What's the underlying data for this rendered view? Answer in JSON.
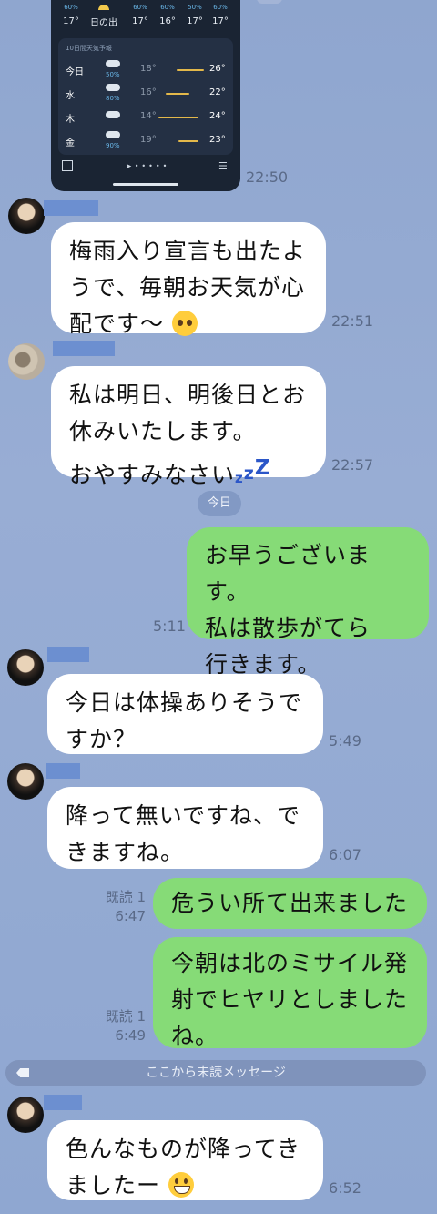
{
  "weather_card": {
    "hourly": [
      {
        "pct": "60%",
        "label": "17°"
      },
      {
        "pct": "",
        "label": "日の出"
      },
      {
        "pct": "60%",
        "label": "17°"
      },
      {
        "pct": "60%",
        "label": "16°"
      },
      {
        "pct": "50%",
        "label": "17°"
      },
      {
        "pct": "60%",
        "label": "17°"
      }
    ],
    "forecast_title": "10日間天気予報",
    "days": [
      {
        "day": "今日",
        "pct": "50%",
        "low": "18°",
        "high": "26°"
      },
      {
        "day": "水",
        "pct": "80%",
        "low": "16°",
        "high": "22°"
      },
      {
        "day": "木",
        "pct": "",
        "low": "14°",
        "high": "24°"
      },
      {
        "day": "金",
        "pct": "90%",
        "low": "19°",
        "high": "23°"
      }
    ]
  },
  "messages": [
    {
      "time": "22:50"
    },
    {
      "text_lines": [
        "梅雨入り宣言も出たよ",
        "うで、毎朝お天気が心",
        "配です〜"
      ],
      "time": "22:51",
      "emoji": "pleading-face"
    },
    {
      "text_lines": [
        "私は明日、明後日とお",
        "休みいたします。",
        "おやすみなさい"
      ],
      "time": "22:57",
      "emoji": "zzz"
    },
    {
      "text_lines": [
        "お早うございます。",
        "私は散歩がてら",
        "行きます。"
      ],
      "time": "5:11"
    },
    {
      "text_lines": [
        "今日は体操ありそうで",
        "すか？"
      ],
      "time": "5:49"
    },
    {
      "text_lines": [
        "降って無いですね、で",
        "きますね。"
      ],
      "time": "6:07"
    },
    {
      "text_lines": [
        "危うい所て出来ました"
      ],
      "read": "既読 1",
      "time": "6:47"
    },
    {
      "text_lines": [
        "今朝は北のミサイル発",
        "射でヒヤリとしました",
        "ね。"
      ],
      "read": "既読 1",
      "time": "6:49"
    },
    {
      "text_lines": [
        "色んなものが降ってき",
        "ましたー"
      ],
      "time": "6:52",
      "emoji": "grinning-face"
    }
  ],
  "day_separator": "今日",
  "unread_separator": "ここから未読メッセージ",
  "colors": {
    "outgoing": "#86db77",
    "incoming": "#ffffff",
    "background": "#8fa6cf"
  }
}
